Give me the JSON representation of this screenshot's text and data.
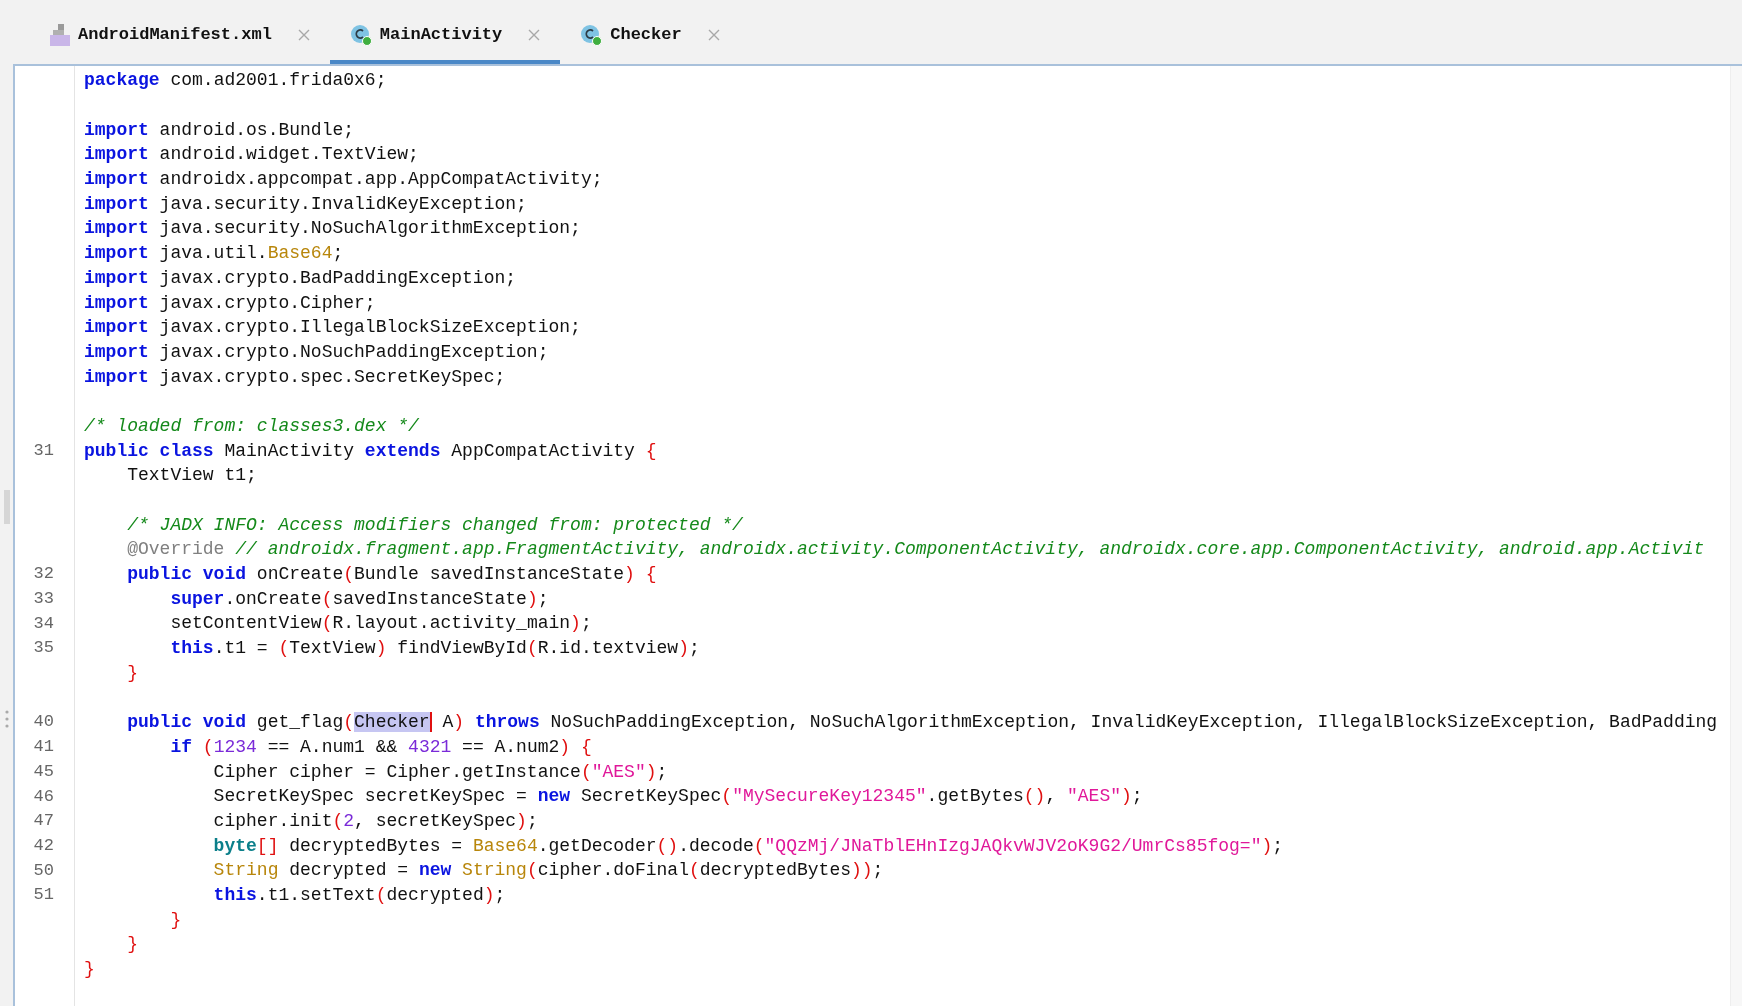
{
  "tabs": [
    {
      "label": "AndroidManifest.xml",
      "kind": "manifest",
      "selected": false
    },
    {
      "label": "MainActivity",
      "kind": "class",
      "selected": true
    },
    {
      "label": "Checker",
      "kind": "class",
      "selected": false
    }
  ],
  "editor": {
    "lines": [
      {
        "kind": "code",
        "tokens": [
          {
            "kind": "keyword",
            "t": "package"
          },
          {
            "kind": "plain",
            "t": " com.ad2001.frida0x6;"
          }
        ]
      },
      {
        "kind": "blank"
      },
      {
        "kind": "code",
        "tokens": [
          {
            "kind": "keyword",
            "t": "import"
          },
          {
            "kind": "plain",
            "t": " android.os.Bundle;"
          }
        ]
      },
      {
        "kind": "code",
        "tokens": [
          {
            "kind": "keyword",
            "t": "import"
          },
          {
            "kind": "plain",
            "t": " android.widget.TextView;"
          }
        ]
      },
      {
        "kind": "code",
        "tokens": [
          {
            "kind": "keyword",
            "t": "import"
          },
          {
            "kind": "plain",
            "t": " androidx.appcompat.app.AppCompatActivity;"
          }
        ]
      },
      {
        "kind": "code",
        "tokens": [
          {
            "kind": "keyword",
            "t": "import"
          },
          {
            "kind": "plain",
            "t": " java.security.InvalidKeyException;"
          }
        ]
      },
      {
        "kind": "code",
        "tokens": [
          {
            "kind": "keyword",
            "t": "import"
          },
          {
            "kind": "plain",
            "t": " java.security.NoSuchAlgorithmException;"
          }
        ]
      },
      {
        "kind": "code",
        "tokens": [
          {
            "kind": "keyword",
            "t": "import"
          },
          {
            "kind": "plain",
            "t": " java.util."
          },
          {
            "kind": "type",
            "t": "Base64"
          },
          {
            "kind": "plain",
            "t": ";"
          }
        ]
      },
      {
        "kind": "code",
        "tokens": [
          {
            "kind": "keyword",
            "t": "import"
          },
          {
            "kind": "plain",
            "t": " javax.crypto.BadPaddingException;"
          }
        ]
      },
      {
        "kind": "code",
        "tokens": [
          {
            "kind": "keyword",
            "t": "import"
          },
          {
            "kind": "plain",
            "t": " javax.crypto.Cipher;"
          }
        ]
      },
      {
        "kind": "code",
        "tokens": [
          {
            "kind": "keyword",
            "t": "import"
          },
          {
            "kind": "plain",
            "t": " javax.crypto.IllegalBlockSizeException;"
          }
        ]
      },
      {
        "kind": "code",
        "tokens": [
          {
            "kind": "keyword",
            "t": "import"
          },
          {
            "kind": "plain",
            "t": " javax.crypto.NoSuchPaddingException;"
          }
        ]
      },
      {
        "kind": "code",
        "tokens": [
          {
            "kind": "keyword",
            "t": "import"
          },
          {
            "kind": "plain",
            "t": " javax.crypto.spec.SecretKeySpec;"
          }
        ]
      },
      {
        "kind": "blank"
      },
      {
        "kind": "code",
        "tokens": [
          {
            "kind": "comment",
            "t": "/* loaded from: classes3.dex */"
          }
        ]
      },
      {
        "kind": "code",
        "number": "31",
        "tokens": [
          {
            "kind": "keyword",
            "t": "public class"
          },
          {
            "kind": "plain",
            "t": " MainActivity "
          },
          {
            "kind": "keyword",
            "t": "extends"
          },
          {
            "kind": "plain",
            "t": " AppCompatActivity "
          },
          {
            "kind": "paren",
            "t": "{"
          }
        ]
      },
      {
        "kind": "code",
        "tokens": [
          {
            "kind": "plain",
            "t": "    TextView t1;"
          }
        ]
      },
      {
        "kind": "blank"
      },
      {
        "kind": "code",
        "tokens": [
          {
            "kind": "comment",
            "t": "    /* JADX INFO: Access modifiers changed from: protected */"
          }
        ]
      },
      {
        "kind": "code",
        "tokens": [
          {
            "kind": "annotation",
            "t": "    @Override"
          },
          {
            "kind": "comment",
            "t": " // androidx.fragment.app.FragmentActivity, androidx.activity.ComponentActivity, androidx.core.app.ComponentActivity, android.app.Activit"
          }
        ]
      },
      {
        "kind": "code",
        "number": "32",
        "tokens": [
          {
            "kind": "keyword",
            "t": "    public void"
          },
          {
            "kind": "plain",
            "t": " onCreate"
          },
          {
            "kind": "paren",
            "t": "("
          },
          {
            "kind": "plain",
            "t": "Bundle savedInstanceState"
          },
          {
            "kind": "paren",
            "t": ")"
          },
          {
            "kind": "paren",
            "t": " {"
          }
        ]
      },
      {
        "kind": "code",
        "number": "33",
        "tokens": [
          {
            "kind": "keyword",
            "t": "        super"
          },
          {
            "kind": "plain",
            "t": ".onCreate"
          },
          {
            "kind": "paren",
            "t": "("
          },
          {
            "kind": "plain",
            "t": "savedInstanceState"
          },
          {
            "kind": "paren",
            "t": ")"
          },
          {
            "kind": "plain",
            "t": ";"
          }
        ]
      },
      {
        "kind": "code",
        "number": "34",
        "tokens": [
          {
            "kind": "plain",
            "t": "        setContentView"
          },
          {
            "kind": "paren",
            "t": "("
          },
          {
            "kind": "plain",
            "t": "R.layout.activity_main"
          },
          {
            "kind": "paren",
            "t": ")"
          },
          {
            "kind": "plain",
            "t": ";"
          }
        ]
      },
      {
        "kind": "code",
        "number": "35",
        "tokens": [
          {
            "kind": "keyword",
            "t": "        this"
          },
          {
            "kind": "plain",
            "t": ".t1 = "
          },
          {
            "kind": "paren",
            "t": "("
          },
          {
            "kind": "plain",
            "t": "TextView"
          },
          {
            "kind": "paren",
            "t": ")"
          },
          {
            "kind": "plain",
            "t": " findViewById"
          },
          {
            "kind": "paren",
            "t": "("
          },
          {
            "kind": "plain",
            "t": "R.id.textview"
          },
          {
            "kind": "paren",
            "t": ")"
          },
          {
            "kind": "plain",
            "t": ";"
          }
        ]
      },
      {
        "kind": "code",
        "tokens": [
          {
            "kind": "paren",
            "t": "    }"
          }
        ]
      },
      {
        "kind": "blank"
      },
      {
        "kind": "code",
        "number": "40",
        "tokens": [
          {
            "kind": "keyword",
            "t": "    public void"
          },
          {
            "kind": "plain",
            "t": " get_flag"
          },
          {
            "kind": "paren",
            "t": "("
          },
          {
            "kind": "selection",
            "t": "Checker",
            "caret": true
          },
          {
            "kind": "plain",
            "t": " A"
          },
          {
            "kind": "paren",
            "t": ")"
          },
          {
            "kind": "keyword",
            "t": " throws"
          },
          {
            "kind": "plain",
            "t": " NoSuchPaddingException, NoSuchAlgorithmException, InvalidKeyException, IllegalBlockSizeException, BadPadding"
          }
        ]
      },
      {
        "kind": "code",
        "number": "41",
        "tokens": [
          {
            "kind": "keyword",
            "t": "        if"
          },
          {
            "kind": "paren",
            "t": " ("
          },
          {
            "kind": "number",
            "t": "1234"
          },
          {
            "kind": "plain",
            "t": " == A.num1 && "
          },
          {
            "kind": "number",
            "t": "4321"
          },
          {
            "kind": "plain",
            "t": " == A.num2"
          },
          {
            "kind": "paren",
            "t": ")"
          },
          {
            "kind": "paren",
            "t": " {"
          }
        ]
      },
      {
        "kind": "code",
        "number": "45",
        "tokens": [
          {
            "kind": "plain",
            "t": "            Cipher cipher = Cipher.getInstance"
          },
          {
            "kind": "paren",
            "t": "("
          },
          {
            "kind": "string",
            "t": "\"AES\""
          },
          {
            "kind": "paren",
            "t": ")"
          },
          {
            "kind": "plain",
            "t": ";"
          }
        ]
      },
      {
        "kind": "code",
        "number": "46",
        "tokens": [
          {
            "kind": "plain",
            "t": "            SecretKeySpec secretKeySpec = "
          },
          {
            "kind": "keyword",
            "t": "new"
          },
          {
            "kind": "plain",
            "t": " SecretKeySpec"
          },
          {
            "kind": "paren",
            "t": "("
          },
          {
            "kind": "string",
            "t": "\"MySecureKey12345\""
          },
          {
            "kind": "plain",
            "t": ".getBytes"
          },
          {
            "kind": "paren",
            "t": "()"
          },
          {
            "kind": "plain",
            "t": ", "
          },
          {
            "kind": "string",
            "t": "\"AES\""
          },
          {
            "kind": "paren",
            "t": ")"
          },
          {
            "kind": "plain",
            "t": ";"
          }
        ]
      },
      {
        "kind": "code",
        "number": "47",
        "tokens": [
          {
            "kind": "plain",
            "t": "            cipher.init"
          },
          {
            "kind": "paren",
            "t": "("
          },
          {
            "kind": "number",
            "t": "2"
          },
          {
            "kind": "plain",
            "t": ", secretKeySpec"
          },
          {
            "kind": "paren",
            "t": ")"
          },
          {
            "kind": "plain",
            "t": ";"
          }
        ]
      },
      {
        "kind": "code",
        "number": "42",
        "tokens": [
          {
            "kind": "primitive",
            "t": "            byte"
          },
          {
            "kind": "paren",
            "t": "[]"
          },
          {
            "kind": "plain",
            "t": " decryptedBytes = "
          },
          {
            "kind": "type",
            "t": "Base64"
          },
          {
            "kind": "plain",
            "t": ".getDecoder"
          },
          {
            "kind": "paren",
            "t": "()"
          },
          {
            "kind": "plain",
            "t": ".decode"
          },
          {
            "kind": "paren",
            "t": "("
          },
          {
            "kind": "string",
            "t": "\"QQzMj/JNaTblEHnIzgJAQkvWJV2oK9G2/UmrCs85fog=\""
          },
          {
            "kind": "paren",
            "t": ")"
          },
          {
            "kind": "plain",
            "t": ";"
          }
        ]
      },
      {
        "kind": "code",
        "number": "50",
        "tokens": [
          {
            "kind": "type",
            "t": "            String"
          },
          {
            "kind": "plain",
            "t": " decrypted = "
          },
          {
            "kind": "keyword",
            "t": "new"
          },
          {
            "kind": "type",
            "t": " String"
          },
          {
            "kind": "paren",
            "t": "("
          },
          {
            "kind": "plain",
            "t": "cipher.doFinal"
          },
          {
            "kind": "paren",
            "t": "("
          },
          {
            "kind": "plain",
            "t": "decryptedBytes"
          },
          {
            "kind": "paren",
            "t": "))"
          },
          {
            "kind": "plain",
            "t": ";"
          }
        ]
      },
      {
        "kind": "code",
        "number": "51",
        "tokens": [
          {
            "kind": "keyword",
            "t": "            this"
          },
          {
            "kind": "plain",
            "t": ".t1.setText"
          },
          {
            "kind": "paren",
            "t": "("
          },
          {
            "kind": "plain",
            "t": "decrypted"
          },
          {
            "kind": "paren",
            "t": ")"
          },
          {
            "kind": "plain",
            "t": ";"
          }
        ]
      },
      {
        "kind": "code",
        "tokens": [
          {
            "kind": "paren",
            "t": "        }"
          }
        ]
      },
      {
        "kind": "code",
        "tokens": [
          {
            "kind": "paren",
            "t": "    }"
          }
        ]
      },
      {
        "kind": "code",
        "tokens": [
          {
            "kind": "paren",
            "t": "}"
          }
        ]
      }
    ]
  }
}
